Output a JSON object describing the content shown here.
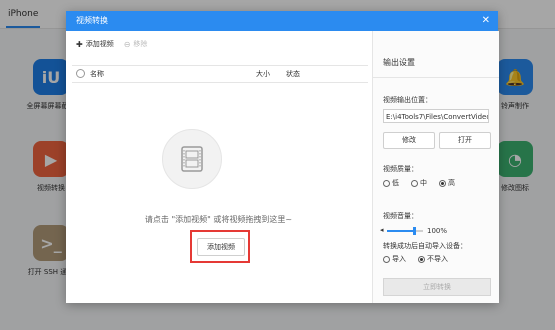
{
  "topbar": {
    "tab_label": "iPhone"
  },
  "background_apps": [
    {
      "label": "全屏幕屏幕截图",
      "color": "#1e7fe8",
      "glyph": "iU"
    },
    {
      "label": "视频转换",
      "color": "#f0653f",
      "glyph": "▶"
    },
    {
      "label": "打开 SSH 通道",
      "color": "#b39b7a",
      "glyph": ">_"
    },
    {
      "label": "铃声制作",
      "color": "#2b8bf0",
      "glyph": "🔔"
    },
    {
      "label": "修改图标",
      "color": "#3cb371",
      "glyph": "◔"
    }
  ],
  "dialog": {
    "title": "视频转换",
    "close_glyph": "✕",
    "toolbar": {
      "add_label": "添加视频",
      "remove_label": "移除"
    },
    "list": {
      "col_name": "名称",
      "col_size": "大小",
      "col_status": "状态"
    },
    "empty_hint": "请点击 \"添加视频\" 或将视频拖拽到这里~",
    "add_video_button": "添加视频",
    "settings": {
      "title": "输出设置",
      "output_path_label": "视频输出位置：",
      "output_path_value": "E:\\i4Tools7\\Files\\ConvertVideo",
      "modify_button": "修改",
      "open_button": "打开",
      "quality_label": "视频质量：",
      "quality_options": [
        "低",
        "中",
        "高"
      ],
      "quality_selected": "高",
      "volume_label": "视频音量：",
      "volume_value": "100%",
      "volume_fraction": 0.75,
      "import_label": "转换成功后自动导入设备：",
      "import_options": [
        "导入",
        "不导入"
      ],
      "import_selected": "不导入",
      "convert_button": "立即转换"
    }
  }
}
